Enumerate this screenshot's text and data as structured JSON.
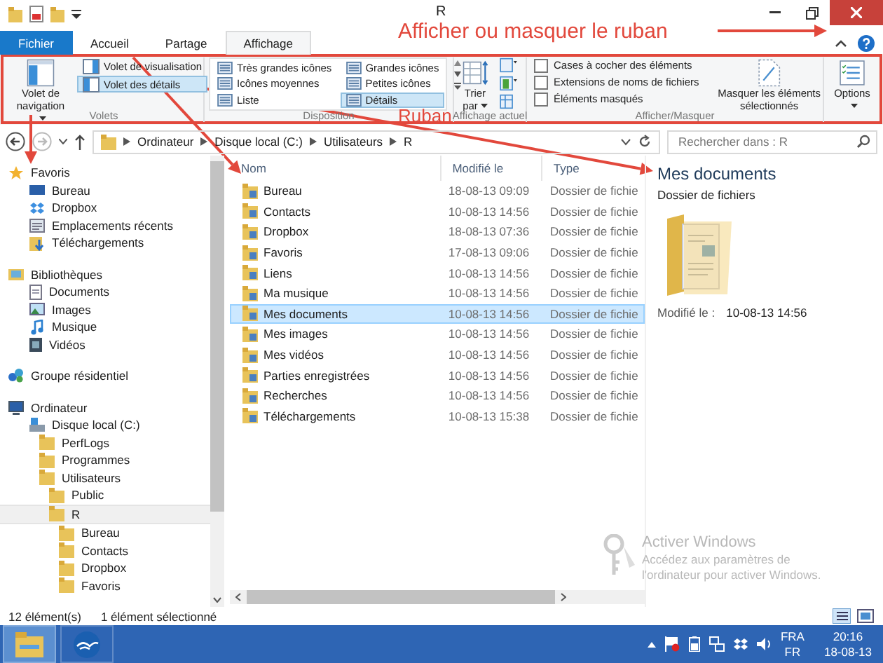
{
  "window": {
    "title": "R"
  },
  "tabs": [
    {
      "label": "Fichier",
      "kind": "file",
      "selected": false
    },
    {
      "label": "Accueil",
      "kind": "tab",
      "selected": false
    },
    {
      "label": "Partage",
      "kind": "tab",
      "selected": false
    },
    {
      "label": "Affichage",
      "kind": "tab",
      "selected": true
    }
  ],
  "annotations": [
    "Afficher ou masquer le ruban",
    "Ruban"
  ],
  "ribbon": {
    "groups": [
      {
        "label": "Volets",
        "kind": "buttons",
        "items": [
          {
            "kind": "large",
            "label": "Volet de navigation",
            "dropdown": true
          },
          {
            "kind": "small",
            "label": "Volet de visualisation",
            "selected": false
          },
          {
            "kind": "small",
            "label": "Volet des détails",
            "selected": true
          }
        ]
      },
      {
        "label": "Disposition",
        "kind": "gallery",
        "items": [
          {
            "label": "Très grandes icônes",
            "selected": false
          },
          {
            "label": "Grandes icônes",
            "selected": false
          },
          {
            "label": "Icônes moyennes",
            "selected": false
          },
          {
            "label": "Petites icônes",
            "selected": false
          },
          {
            "label": "Liste",
            "selected": false
          },
          {
            "label": "Détails",
            "selected": true
          }
        ]
      },
      {
        "label": "Affichage actuel",
        "kind": "buttons",
        "items": [
          {
            "kind": "large",
            "label": "Trier par",
            "dropdown": true
          },
          {
            "kind": "icon"
          },
          {
            "kind": "icon"
          },
          {
            "kind": "icon"
          }
        ]
      },
      {
        "label": "Afficher/Masquer",
        "kind": "buttons",
        "items": [
          {
            "kind": "check",
            "label": "Cases à cocher des éléments",
            "checked": false
          },
          {
            "kind": "check",
            "label": "Extensions de noms de fichiers",
            "checked": false
          },
          {
            "kind": "check",
            "label": "Éléments masqués",
            "checked": false
          },
          {
            "kind": "large",
            "label": "Masquer les éléments sélectionnés",
            "dropdown": false
          }
        ]
      },
      {
        "kind": "buttons",
        "items": [
          {
            "kind": "large",
            "label": "Options",
            "dropdown": true
          }
        ]
      }
    ]
  },
  "address": {
    "path": [
      "Ordinateur",
      "Disque local (C:)",
      "Utilisateurs",
      "R"
    ],
    "search": {
      "placeholder": "Rechercher dans : R"
    }
  },
  "navigation": [
    {
      "label": "Favoris",
      "kind": "star",
      "selected": false,
      "children": [
        {
          "label": "Bureau",
          "kind": "monitor",
          "selected": false
        },
        {
          "label": "Dropbox",
          "kind": "dropbox",
          "selected": false
        },
        {
          "label": "Emplacements récents",
          "kind": "recent",
          "selected": false
        },
        {
          "label": "Téléchargements",
          "kind": "download",
          "selected": false
        }
      ]
    },
    {
      "label": "Bibliothèques",
      "kind": "library",
      "selected": false,
      "children": [
        {
          "label": "Documents",
          "kind": "document",
          "selected": false
        },
        {
          "label": "Images",
          "kind": "image",
          "selected": false
        },
        {
          "label": "Musique",
          "kind": "music",
          "selected": false
        },
        {
          "label": "Vidéos",
          "kind": "video",
          "selected": false
        }
      ]
    },
    {
      "label": "Groupe résidentiel",
      "kind": "homegroup",
      "selected": false
    },
    {
      "label": "Ordinateur",
      "kind": "computer",
      "selected": false,
      "children": [
        {
          "label": "Disque local (C:)",
          "kind": "drive",
          "selected": false,
          "children": [
            {
              "label": "PerfLogs",
              "kind": "folder",
              "selected": false
            },
            {
              "label": "Programmes",
              "kind": "folder",
              "selected": false
            },
            {
              "label": "Utilisateurs",
              "kind": "folder",
              "selected": false,
              "children": [
                {
                  "label": "Public",
                  "kind": "folder",
                  "selected": false
                },
                {
                  "label": "R",
                  "kind": "folder",
                  "selected": true,
                  "children": [
                    {
                      "label": "Bureau",
                      "kind": "folder",
                      "selected": false
                    },
                    {
                      "label": "Contacts",
                      "kind": "folder",
                      "selected": false
                    },
                    {
                      "label": "Dropbox",
                      "kind": "folder",
                      "selected": false
                    },
                    {
                      "label": "Favoris",
                      "kind": "folder",
                      "selected": false
                    }
                  ]
                }
              ]
            }
          ]
        }
      ]
    }
  ],
  "files": {
    "columns": [
      "Nom",
      "Modifié le",
      "Type"
    ],
    "rows": [
      {
        "name": "Bureau",
        "modified": "18-08-13 09:09",
        "type": "Dossier de fichie",
        "selected": false
      },
      {
        "name": "Contacts",
        "modified": "10-08-13 14:56",
        "type": "Dossier de fichie",
        "selected": false
      },
      {
        "name": "Dropbox",
        "modified": "18-08-13 07:36",
        "type": "Dossier de fichie",
        "selected": false
      },
      {
        "name": "Favoris",
        "modified": "17-08-13 09:06",
        "type": "Dossier de fichie",
        "selected": false
      },
      {
        "name": "Liens",
        "modified": "10-08-13 14:56",
        "type": "Dossier de fichie",
        "selected": false
      },
      {
        "name": "Ma musique",
        "modified": "10-08-13 14:56",
        "type": "Dossier de fichie",
        "selected": false
      },
      {
        "name": "Mes documents",
        "modified": "10-08-13 14:56",
        "type": "Dossier de fichie",
        "selected": true
      },
      {
        "name": "Mes images",
        "modified": "10-08-13 14:56",
        "type": "Dossier de fichie",
        "selected": false
      },
      {
        "name": "Mes vidéos",
        "modified": "10-08-13 14:56",
        "type": "Dossier de fichie",
        "selected": false
      },
      {
        "name": "Parties enregistrées",
        "modified": "10-08-13 14:56",
        "type": "Dossier de fichie",
        "selected": false
      },
      {
        "name": "Recherches",
        "modified": "10-08-13 14:56",
        "type": "Dossier de fichie",
        "selected": false
      },
      {
        "name": "Téléchargements",
        "modified": "10-08-13 15:38",
        "type": "Dossier de fichie",
        "selected": false
      }
    ]
  },
  "preview": {
    "title": "Mes documents",
    "subtitle": "Dossier de fichiers",
    "modified_label": "Modifié le :",
    "modified": "10-08-13 14:56"
  },
  "activation_notice": {
    "title": "Activer Windows",
    "text": "Accédez aux paramètres de l'ordinateur pour activer Windows."
  },
  "status_bar": {
    "count": "12 élément(s)",
    "selection": "1 élément sélectionné"
  },
  "taskbar": {
    "apps": [
      {
        "selected": true
      },
      {
        "selected": false
      }
    ],
    "language": "FRA",
    "layout": "FR",
    "time": "20:16",
    "date": "18-08-13"
  }
}
